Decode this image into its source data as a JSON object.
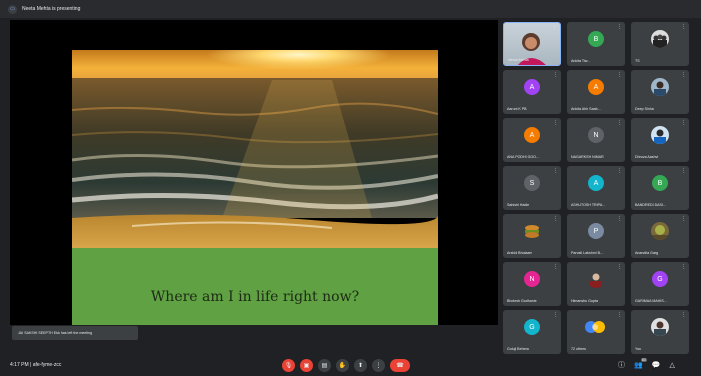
{
  "topbar": {
    "presenting_text": "Neeta Mehta is presenting"
  },
  "slide": {
    "caption": "Where am I in life right now?"
  },
  "toast": {
    "text": "JAI SAKSHI SEEPTH Ekk has left the meeting"
  },
  "participants": [
    {
      "name": "Neeta Mehta",
      "initial": "",
      "color": "",
      "video": true
    },
    {
      "name": "Ankita Tiw...",
      "initial": "B",
      "color": "#34a853",
      "video": false
    },
    {
      "name": "TS",
      "initial": "",
      "color": "",
      "video": false,
      "image": "group-photo"
    },
    {
      "name": "Aaruni K PB",
      "initial": "A",
      "color": "#a142f4",
      "video": false
    },
    {
      "name": "Ankita Ahh Saab...",
      "initial": "A",
      "color": "#f57c00",
      "video": false
    },
    {
      "name": "Deep Sinha",
      "initial": "",
      "color": "",
      "video": false,
      "image": "person-photo"
    },
    {
      "name": "ANA PODHI GOO...",
      "initial": "A",
      "color": "#f57c00",
      "video": false
    },
    {
      "name": "NAGARKSH NIMAR",
      "initial": "N",
      "color": "#5f6368",
      "video": false
    },
    {
      "name": "Dhruva Aashvi",
      "initial": "",
      "color": "",
      "video": false,
      "image": "person-photo"
    },
    {
      "name": "Sahishi Hadie",
      "initial": "S",
      "color": "#5f6368",
      "video": false
    },
    {
      "name": "ASHUTOSH TRIPA...",
      "initial": "A",
      "color": "#12b5cb",
      "video": false
    },
    {
      "name": "BANDREDI DASI...",
      "initial": "B",
      "color": "#34a853",
      "video": false
    },
    {
      "name": "Arshid Bholaam",
      "initial": "",
      "color": "",
      "video": false,
      "image": "food-photo"
    },
    {
      "name": "Parvati Lakshmi B...",
      "initial": "P",
      "color": "#5f6368",
      "video": false
    },
    {
      "name": "Anandita Garg",
      "initial": "",
      "color": "",
      "video": false,
      "image": "nature-photo"
    },
    {
      "name": "Bholesh Godhanie",
      "initial": "N",
      "color": "#e52592",
      "video": false
    },
    {
      "name": "Himanshu Gupta",
      "initial": "",
      "color": "",
      "video": false,
      "image": "person-photo"
    },
    {
      "name": "GARIMAA MAHIS...",
      "initial": "G",
      "color": "#a142f4",
      "video": false
    },
    {
      "name": "Guluji Behera",
      "initial": "G",
      "color": "#12b5cb",
      "video": false
    },
    {
      "name": "72 others",
      "initial": "",
      "color": "",
      "video": false,
      "image": "others-stack"
    },
    {
      "name": "You",
      "initial": "",
      "color": "",
      "video": false,
      "image": "person-photo"
    }
  ],
  "bottombar": {
    "time_meeting": "4:17 PM  |  afe-fyme-zcc",
    "participant_count": "83"
  },
  "icons": {
    "mic": "mic-off-icon",
    "camera": "camera-off-icon",
    "captions": "captions-icon",
    "hand": "raise-hand-icon",
    "present": "present-icon",
    "more": "more-options-icon",
    "end": "end-call-icon",
    "info": "info-icon",
    "people": "people-icon",
    "chat": "chat-icon",
    "activities": "activities-icon"
  }
}
